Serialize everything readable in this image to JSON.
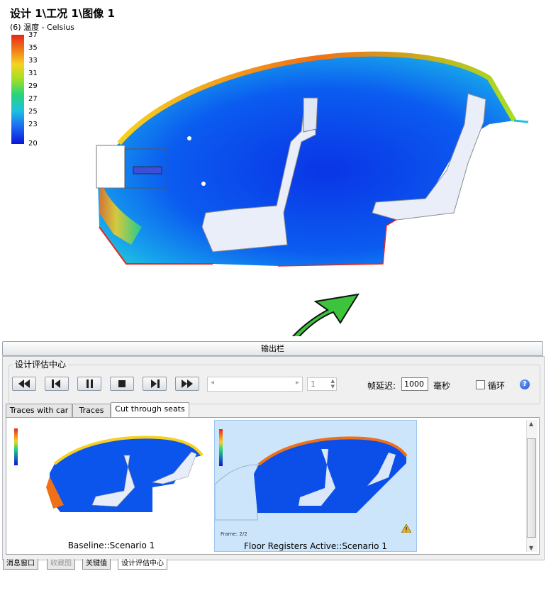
{
  "view": {
    "title": "设计 1\\工况 1\\图像 1",
    "legend_caption": "(6) 温度 - Celsius",
    "legend_ticks": [
      "37",
      "35",
      "33",
      "31",
      "29",
      "27",
      "25",
      "23",
      "20"
    ],
    "colors": {
      "hot": "#e8261a",
      "warm": "#f6d21f",
      "mid": "#27d47c",
      "cool": "#1dbfe3",
      "cold": "#0a16d8"
    }
  },
  "output_bar": {
    "title": "输出栏"
  },
  "design_center": {
    "group_title": "设计评估中心",
    "playback_buttons": [
      "rewind-icon",
      "step-back-icon",
      "pause-icon",
      "stop-icon",
      "step-forward-icon",
      "fast-forward-icon"
    ],
    "frame_value": "1",
    "delay_label": "帧延迟:",
    "delay_value": "1000",
    "ms_label": "毫秒",
    "loop_label": "循环",
    "help_icon": "?"
  },
  "tabs": [
    {
      "label": "Traces with car",
      "active": false
    },
    {
      "label": "Traces",
      "active": false
    },
    {
      "label": "Cut through seats",
      "active": true
    }
  ],
  "thumbnails": [
    {
      "caption": "Baseline::Scenario 1",
      "selected": false
    },
    {
      "caption": "Floor Registers Active::Scenario 1",
      "selected": true,
      "frame_label": "Frame: 2/2",
      "warning_icon": "warning-icon"
    }
  ],
  "bottom_tabs": [
    {
      "label": "消息窗口",
      "active": false,
      "disabled": false
    },
    {
      "label": "收藏图",
      "active": false,
      "disabled": true
    },
    {
      "label": "关键值",
      "active": false,
      "disabled": false
    },
    {
      "label": "设计评估中心",
      "active": true,
      "disabled": false
    }
  ]
}
